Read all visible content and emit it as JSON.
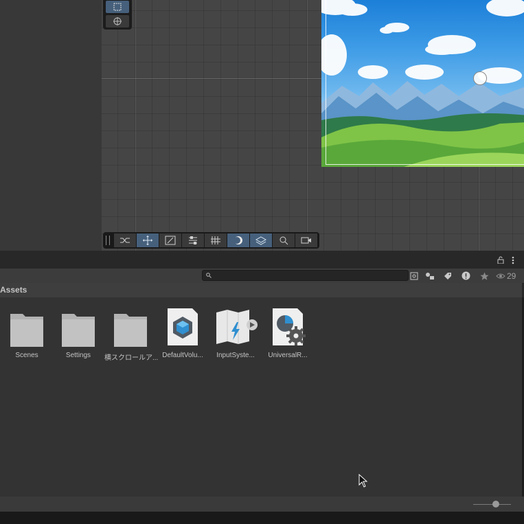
{
  "project": {
    "breadcrumb": "Assets",
    "search": {
      "value": "",
      "placeholder": ""
    },
    "hidden_packages_count": "29",
    "assets": [
      {
        "name": "Scenes",
        "icon": "folder-icon"
      },
      {
        "name": "Settings",
        "icon": "folder-icon"
      },
      {
        "name": "横スクロールア...",
        "icon": "folder-icon"
      },
      {
        "name": "DefaultVolu...",
        "icon": "volume-profile-icon"
      },
      {
        "name": "InputSyste...",
        "icon": "input-actions-icon"
      },
      {
        "name": "UniversalR...",
        "icon": "render-pipeline-asset-icon"
      }
    ],
    "zoom_slider_level": 0.6
  },
  "colors": {
    "active_tool": "#46607c",
    "sky": "#3d9be6",
    "hills": "#6fbf3e",
    "folder": "#c2c2c2"
  }
}
